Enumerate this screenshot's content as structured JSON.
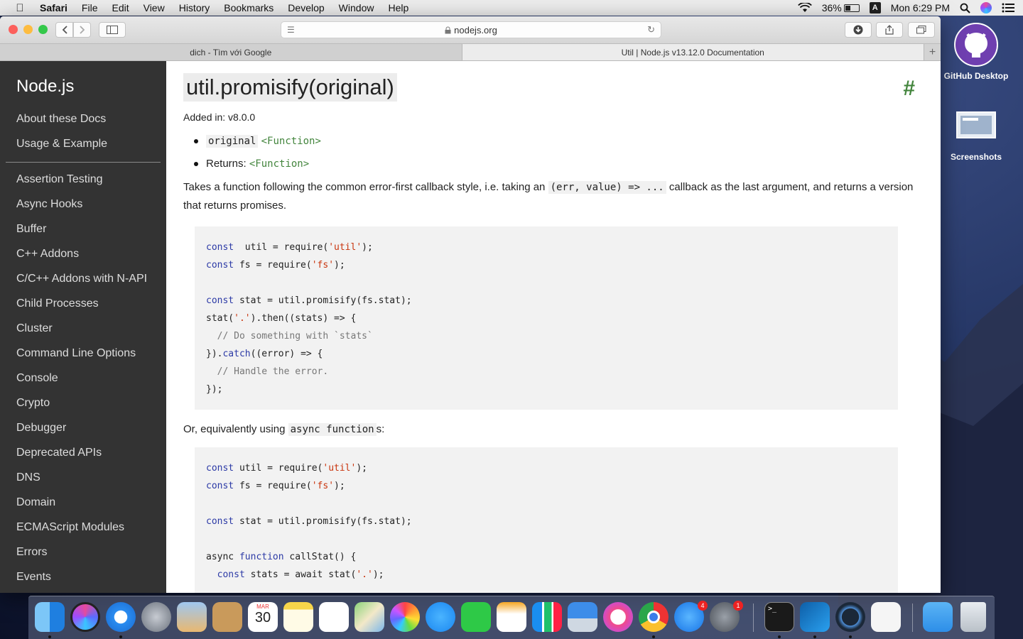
{
  "menubar": {
    "app": "Safari",
    "items": [
      "File",
      "Edit",
      "View",
      "History",
      "Bookmarks",
      "Develop",
      "Window",
      "Help"
    ],
    "battery": "36%",
    "input_source": "A",
    "clock": "Mon 6:29 PM"
  },
  "browser": {
    "url": "nodejs.org",
    "tabs": [
      {
        "title": "dich - Tìm với Google",
        "active": false
      },
      {
        "title": "Util | Node.js v13.12.0 Documentation",
        "active": true
      }
    ],
    "new_tab": "+"
  },
  "sidebar": {
    "brand": "Node.js",
    "top_items": [
      "About these Docs",
      "Usage & Example"
    ],
    "items": [
      "Assertion Testing",
      "Async Hooks",
      "Buffer",
      "C++ Addons",
      "C/C++ Addons with N-API",
      "Child Processes",
      "Cluster",
      "Command Line Options",
      "Console",
      "Crypto",
      "Debugger",
      "Deprecated APIs",
      "DNS",
      "Domain",
      "ECMAScript Modules",
      "Errors",
      "Events"
    ]
  },
  "doc": {
    "heading": "util.promisify(original)",
    "anchor": "#",
    "added": "Added in: v8.0.0",
    "param1_name": "original",
    "param1_type": "<Function>",
    "returns_label": "Returns:",
    "returns_type": "<Function>",
    "desc_before": "Takes a function following the common error-first callback style, i.e. taking an ",
    "desc_code": "(err, value) => ...",
    "desc_after": " callback as the last argument, and returns a version that returns promises.",
    "or_before": "Or, equivalently using ",
    "or_code": "async function",
    "or_after": "s:",
    "code1": [
      [
        [
          "kw",
          "const"
        ],
        [
          "",
          "  util = require("
        ],
        [
          "str",
          "'util'"
        ],
        [
          "",
          ");"
        ]
      ],
      [
        [
          "kw",
          "const"
        ],
        [
          "",
          " fs = require("
        ],
        [
          "str",
          "'fs'"
        ],
        [
          "",
          ");"
        ]
      ],
      [],
      [
        [
          "kw",
          "const"
        ],
        [
          "",
          " stat = util.promisify(fs.stat);"
        ]
      ],
      [
        [
          "",
          "stat("
        ],
        [
          "str",
          "'.'"
        ],
        [
          "",
          ").then((stats) => {"
        ]
      ],
      [
        [
          "cm",
          "  // Do something with `stats`"
        ]
      ],
      [
        [
          "",
          "})."
        ],
        [
          "kw",
          "catch"
        ],
        [
          "",
          "((error) => {"
        ]
      ],
      [
        [
          "cm",
          "  // Handle the error."
        ]
      ],
      [
        [
          "",
          "});"
        ]
      ]
    ],
    "code2": [
      [
        [
          "kw",
          "const"
        ],
        [
          "",
          " util = require("
        ],
        [
          "str",
          "'util'"
        ],
        [
          "",
          ");"
        ]
      ],
      [
        [
          "kw",
          "const"
        ],
        [
          "",
          " fs = require("
        ],
        [
          "str",
          "'fs'"
        ],
        [
          "",
          ");"
        ]
      ],
      [],
      [
        [
          "kw",
          "const"
        ],
        [
          "",
          " stat = util.promisify(fs.stat);"
        ]
      ],
      [],
      [
        [
          "",
          "async "
        ],
        [
          "kw",
          "function"
        ],
        [
          "",
          " callStat() {"
        ]
      ],
      [
        [
          "",
          "  "
        ],
        [
          "kw",
          "const"
        ],
        [
          "",
          " stats = await stat("
        ],
        [
          "str",
          "'.'"
        ],
        [
          "",
          ");"
        ]
      ]
    ]
  },
  "desktop": {
    "icons": [
      "GitHub Desktop",
      "Screenshots"
    ]
  },
  "dock": {
    "apps": [
      "Finder",
      "Siri",
      "Safari",
      "Launchpad",
      "Xcode Preview",
      "Contacts",
      "Calendar",
      "Notes",
      "Reminders",
      "Maps",
      "Photos",
      "Messages",
      "FaceTime",
      "Pages",
      "Numbers",
      "Keynote",
      "Music",
      "Chrome",
      "App Store",
      "System Preferences",
      "Terminal",
      "VS Code",
      "QuickTime",
      "TextEdit",
      "Downloads",
      "Trash"
    ],
    "calendar_month": "MAR",
    "calendar_day": "30",
    "app_store_badge": "4",
    "prefs_badge": "1"
  }
}
